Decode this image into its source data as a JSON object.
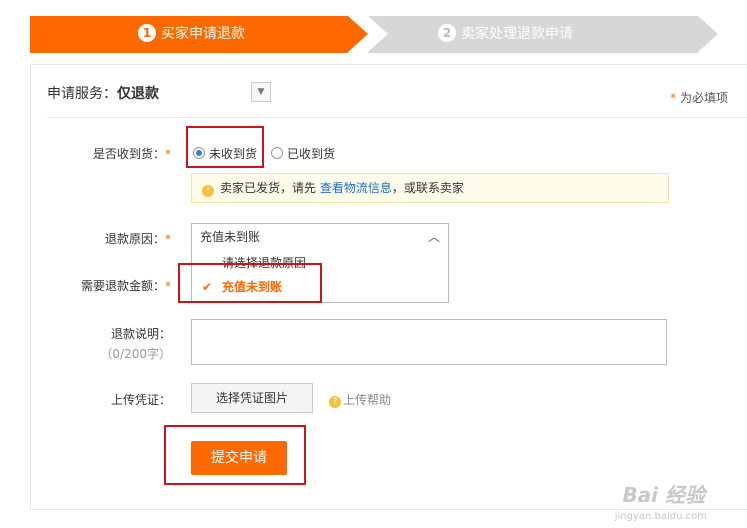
{
  "steps": [
    {
      "num": "1",
      "label": "买家申请退款"
    },
    {
      "num": "2",
      "label": "卖家处理退款申请"
    }
  ],
  "service": {
    "label": "申请服务：",
    "value": "仅退款"
  },
  "required_note": {
    "star": "*",
    "text": "为必填项"
  },
  "received": {
    "label": "是否收到货：",
    "star": "*",
    "options": [
      {
        "label": "未收到货",
        "checked": true
      },
      {
        "label": "已收到货",
        "checked": false
      }
    ]
  },
  "hint": {
    "prefix": "卖家已发货，请先 ",
    "link": "查看物流信息",
    "suffix": "，或联系卖家"
  },
  "reason": {
    "label": "退款原因：",
    "star": "*",
    "selected": "充值未到账",
    "options": [
      "请选择退款原因",
      "充值未到账"
    ]
  },
  "amount": {
    "label": "需要退款金额：",
    "star": "*"
  },
  "note": {
    "label": "退款说明：",
    "counter": "（0/200字）"
  },
  "upload": {
    "label": "上传凭证：",
    "button": "选择凭证图片",
    "help": "上传帮助"
  },
  "submit": {
    "label": "提交申请"
  },
  "watermark": {
    "brand": "Bai 经验",
    "url": "jingyan.baidu.com"
  },
  "colors": {
    "accent": "#ff6a00",
    "step_inactive": "#d7d7d7",
    "highlight_box": "#c9151e",
    "link": "#1f6fbf"
  }
}
